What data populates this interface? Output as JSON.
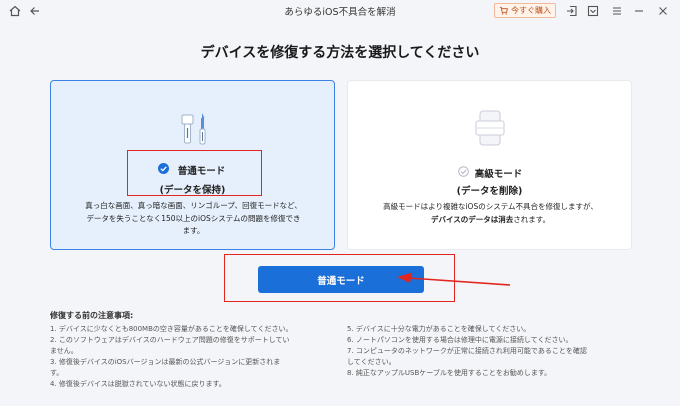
{
  "titlebar": {
    "title": "あらゆるiOS不具合を解消",
    "buy_label": "今すぐ購入",
    "icons": [
      "home-icon",
      "back-icon",
      "cart-icon",
      "sign-in-icon",
      "feedback-icon",
      "menu-icon",
      "minimize-icon",
      "close-icon"
    ]
  },
  "heading": "デバイスを修復する方法を選択してください",
  "standard": {
    "title": "普通モード",
    "subtitle": "(データを保持)",
    "desc_lines": [
      "真っ白な画面、真っ暗な画面、リンゴループ、回復モードなど、",
      "データを失うことなく150以上のiOSシステムの問題を修復でき",
      "ます。"
    ]
  },
  "advanced": {
    "title": "高級モード",
    "subtitle": "(データを削除)",
    "desc_line1": "高級モードはより複雑なiOSのシステム不具合を修復しますが、",
    "desc_line2_bold": "デバイスのデータは消去",
    "desc_line2_rest": "されます。"
  },
  "action_button": "普通モード",
  "notes": {
    "title": "修復する前の注意事項:",
    "left": [
      "1. デバイスに少なくとも800MBの空き容量があることを確保してください。",
      "2. このソフトウェアはデバイスのハードウェア問題の修復をサポートしてい",
      "ません。",
      "3. 修復後デバイスのiOSバージョンは最新の公式バージョンに更新されま",
      "す。",
      "4. 修復後デバイスは脱獄されていない状態に戻ります。"
    ],
    "right": [
      "5. デバイスに十分な電力があることを確保してください。",
      "6. ノートパソコンを使用する場合は修理中に電源に接続してください。",
      "7. コンピュータのネットワークが正常に接続され利用可能であることを確認",
      "してください。",
      "8. 純正なアップルUSBケーブルを使用することをお勧めします。"
    ]
  },
  "colors": {
    "accent": "#1a6fd8",
    "highlight": "#e2261f",
    "selected_bg": "#e6f0fd"
  }
}
